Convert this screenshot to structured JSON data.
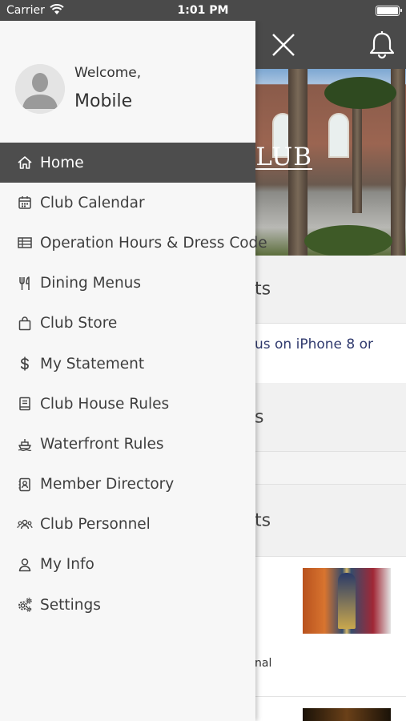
{
  "status_bar": {
    "carrier": "Carrier",
    "time": "1:01 PM"
  },
  "drawer": {
    "welcome": "Welcome,",
    "username": "Mobile",
    "items": [
      {
        "label": "Home",
        "icon": "home-icon",
        "active": true
      },
      {
        "label": "Club Calendar",
        "icon": "calendar-icon"
      },
      {
        "label": "Operation Hours & Dress Code",
        "icon": "table-icon"
      },
      {
        "label": "Dining Menus",
        "icon": "utensils-icon"
      },
      {
        "label": "Club Store",
        "icon": "shopping-bag-icon"
      },
      {
        "label": "My Statement",
        "icon": "dollar-icon"
      },
      {
        "label": "Club House Rules",
        "icon": "book-icon"
      },
      {
        "label": "Waterfront Rules",
        "icon": "ship-icon"
      },
      {
        "label": "Member Directory",
        "icon": "address-book-icon"
      },
      {
        "label": "Club Personnel",
        "icon": "users-icon"
      },
      {
        "label": "My Info",
        "icon": "user-icon"
      },
      {
        "label": "Settings",
        "icon": "cogs-icon"
      }
    ]
  },
  "background": {
    "hero_text": "T CLUB",
    "sections": [
      {
        "text": "ts"
      },
      {
        "text": "s"
      },
      {
        "text": "ts"
      }
    ],
    "link_text": "us on iPhone 8 or",
    "small_text": "nal"
  },
  "colors": {
    "header": "#4a4a4a",
    "active_item": "#4d4d4d",
    "drawer_bg": "#f7f7f7",
    "link": "#303a6e"
  }
}
